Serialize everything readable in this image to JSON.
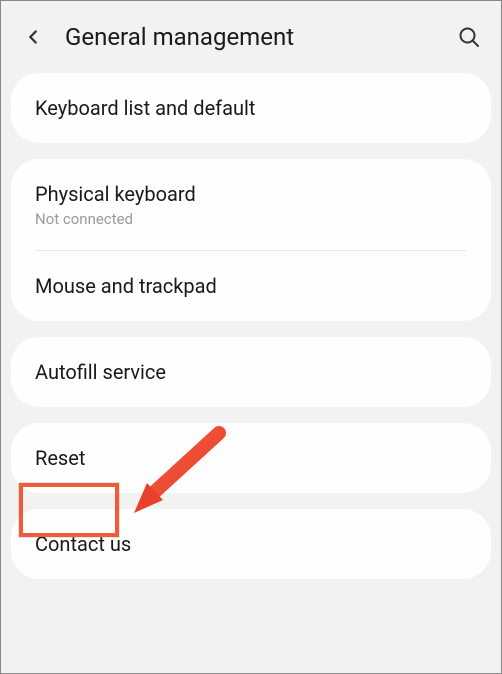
{
  "header": {
    "title": "General management"
  },
  "items": {
    "keyboard_list": "Keyboard list and default",
    "physical_keyboard": "Physical keyboard",
    "physical_keyboard_sub": "Not connected",
    "mouse_trackpad": "Mouse and trackpad",
    "autofill": "Autofill service",
    "reset": "Reset",
    "contact": "Contact us"
  }
}
